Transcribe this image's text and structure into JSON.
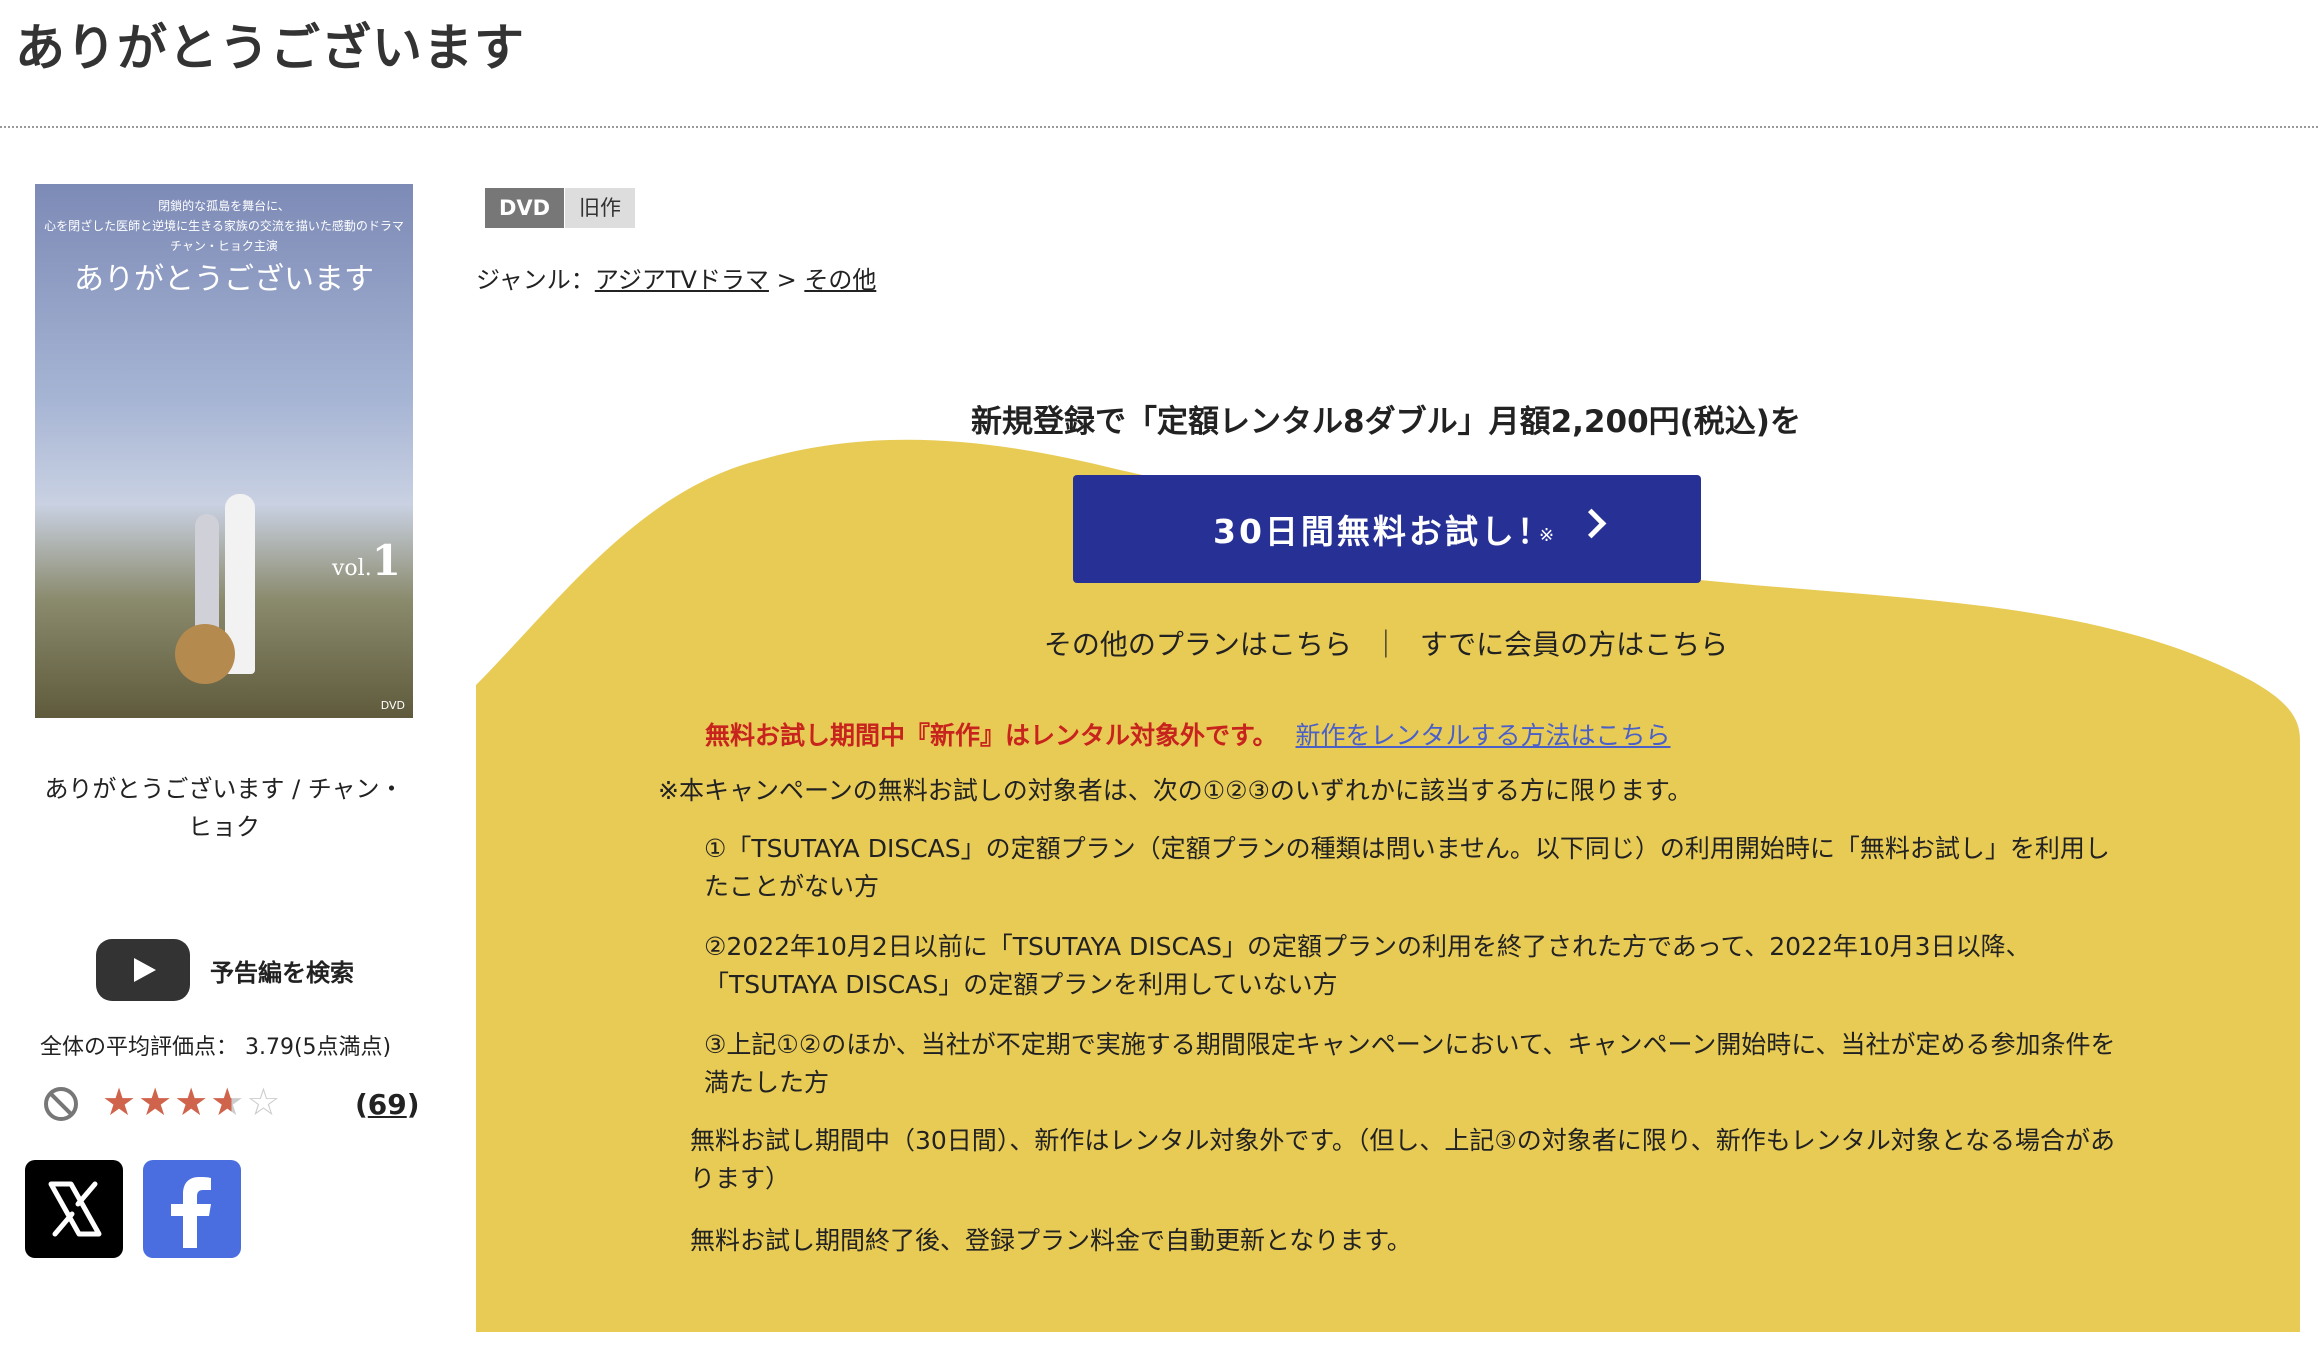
{
  "page": {
    "title": "ありがとうございます"
  },
  "poster": {
    "caption_line1": "閉鎖的な孤島を舞台に、",
    "caption_line2": "心を閉ざした医師と逆境に生きる家族の交流を描いた感動のドラマ",
    "caption_line3": "チャン・ヒョク主演",
    "title": "ありがとうございます",
    "vol_prefix": "vol.",
    "vol_number": "1",
    "corner": "DVD"
  },
  "product": {
    "name": "ありがとうございます / チャン・ヒョク"
  },
  "trailer": {
    "label": "予告編を検索"
  },
  "rating": {
    "label": "全体の平均評価点： 3.79(5点満点)",
    "value": 3.79,
    "max": 5,
    "review_count_open": "(",
    "review_count": "69",
    "review_count_close": ")"
  },
  "tags": {
    "format": "DVD",
    "category": "旧作"
  },
  "genre": {
    "label": "ジャンル：",
    "primary": "アジアTVドラマ",
    "arrow": ">",
    "secondary": "その他"
  },
  "promo": {
    "headline": "新規登録で「定額レンタル8ダブル」月額2,200円(税込)を",
    "cta_label": "30日間無料お試し！",
    "cta_note": "※",
    "other_plans": "その他のプランはこちら",
    "separator": "｜",
    "member_login": "すでに会員の方はこちら",
    "colors": {
      "accent_bg": "#e8cb55",
      "cta": "#273195",
      "warning": "#c8241e",
      "link": "#4a60c8"
    }
  },
  "notice": {
    "warning": "無料お試し期間中『新作』はレンタル対象外です。",
    "link": "新作をレンタルする方法はこちら"
  },
  "terms": {
    "intro": "※本キャンペーンの無料お試しの対象者は、次の①②③のいずれかに該当する方に限ります。",
    "item1": "①「TSUTAYA DISCAS」の定額プラン（定額プランの種類は問いません。以下同じ）の利用開始時に「無料お試し」を利用したことがない方",
    "item2": "②2022年10月2日以前に「TSUTAYA DISCAS」の定額プランの利用を終了された方であって、2022年10月3日以降、「TSUTAYA DISCAS」の定額プランを利用していない方",
    "item3": "③上記①②のほか、当社が不定期で実施する期間限定キャンペーンにおいて、キャンペーン開始時に、当社が定める参加条件を満たした方",
    "note1": "無料お試し期間中（30日間）、新作はレンタル対象外です。（但し、上記③の対象者に限り、新作もレンタル対象となる場合があります）",
    "note2": "無料お試し期間終了後、登録プラン料金で自動更新となります。"
  }
}
